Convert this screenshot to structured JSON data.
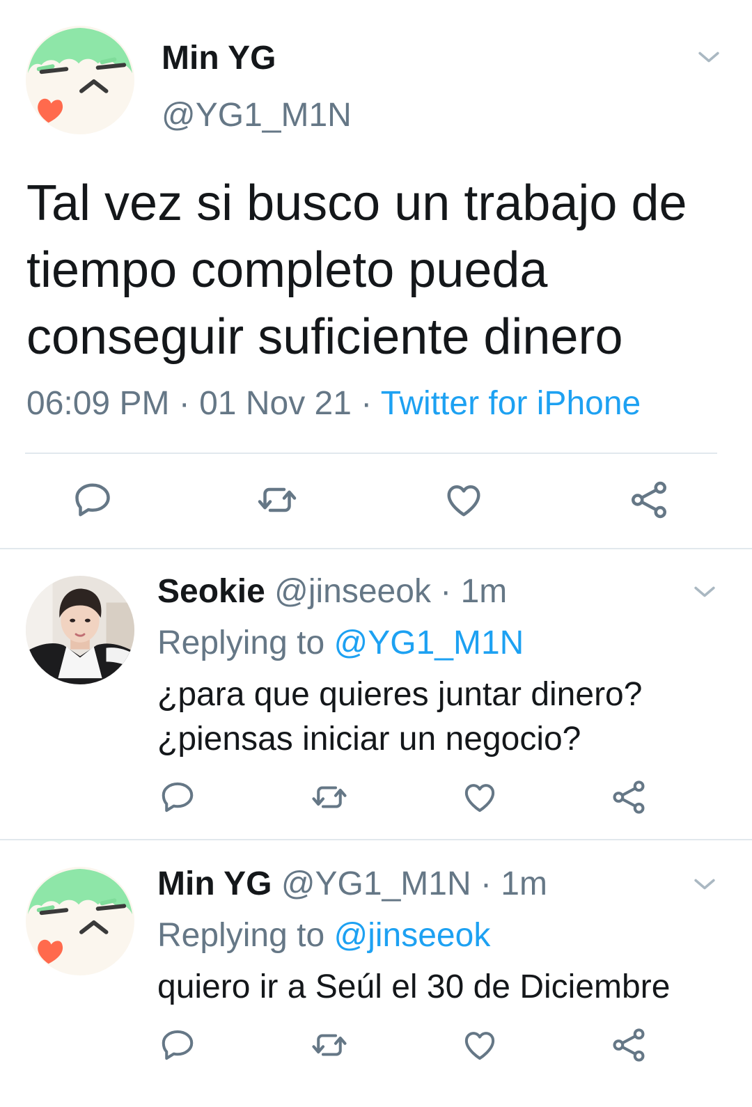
{
  "main_tweet": {
    "name": "Min YG",
    "handle": "@YG1_M1N",
    "text": "Tal vez si busco un trabajo de tiempo completo pueda conseguir suficiente dinero",
    "time": "06:09 PM",
    "separator": " · ",
    "date": "01 Nov 21",
    "source": "Twitter for iPhone",
    "avatar_icon": "cartoon-face-avatar",
    "actions": [
      "reply-icon",
      "retweet-icon",
      "like-icon",
      "share-icon"
    ]
  },
  "replies": [
    {
      "name": "Seokie",
      "handle": "@jinseeok",
      "time": "1m",
      "replying_prefix": "Replying to ",
      "replying_to": "@YG1_M1N",
      "text": "¿para que quieres juntar dinero? ¿piensas iniciar un negocio?",
      "avatar_icon": "photo-avatar"
    },
    {
      "name": "Min YG",
      "handle": "@YG1_M1N",
      "time": "1m",
      "replying_prefix": "Replying to ",
      "replying_to": "@jinseeok",
      "text": "quiero ir a Seúl el 30 de Diciembre",
      "avatar_icon": "cartoon-face-avatar"
    }
  ],
  "colors": {
    "text": "#14171a",
    "muted": "#657786",
    "link": "#1da1f2",
    "divider": "#e1e8ed"
  }
}
